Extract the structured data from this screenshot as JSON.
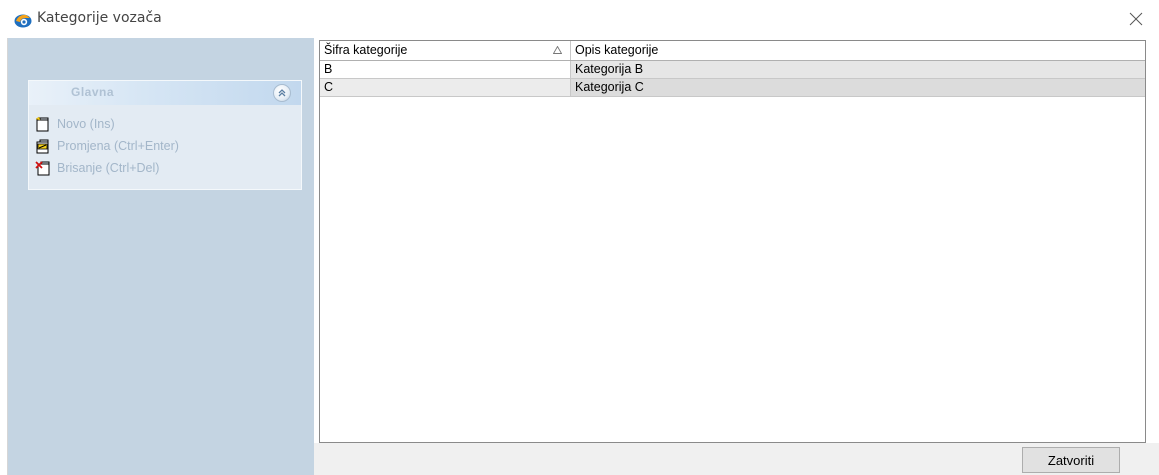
{
  "window": {
    "title": "Kategorije vozača",
    "icon": "app-logo-icon"
  },
  "sidebar": {
    "group_title": "Glavna",
    "items": [
      {
        "label": "Novo (Ins)",
        "icon": "new-document-icon"
      },
      {
        "label": "Promjena (Ctrl+Enter)",
        "icon": "edit-document-icon"
      },
      {
        "label": "Brisanje (Ctrl+Del)",
        "icon": "delete-document-icon"
      }
    ]
  },
  "grid": {
    "columns": [
      {
        "label": "Šifra kategorije",
        "sorted": "ascending"
      },
      {
        "label": "Opis kategorije"
      }
    ],
    "rows": [
      {
        "code": "B",
        "description": "Kategorija B"
      },
      {
        "code": "C",
        "description": "Kategorija C"
      }
    ]
  },
  "footer": {
    "close_label": "Zatvoriti"
  },
  "colors": {
    "sidebar_bg": "#c4d4e2",
    "group_bg": "#e3ebf3",
    "disabled_text": "#a3b6c9"
  }
}
